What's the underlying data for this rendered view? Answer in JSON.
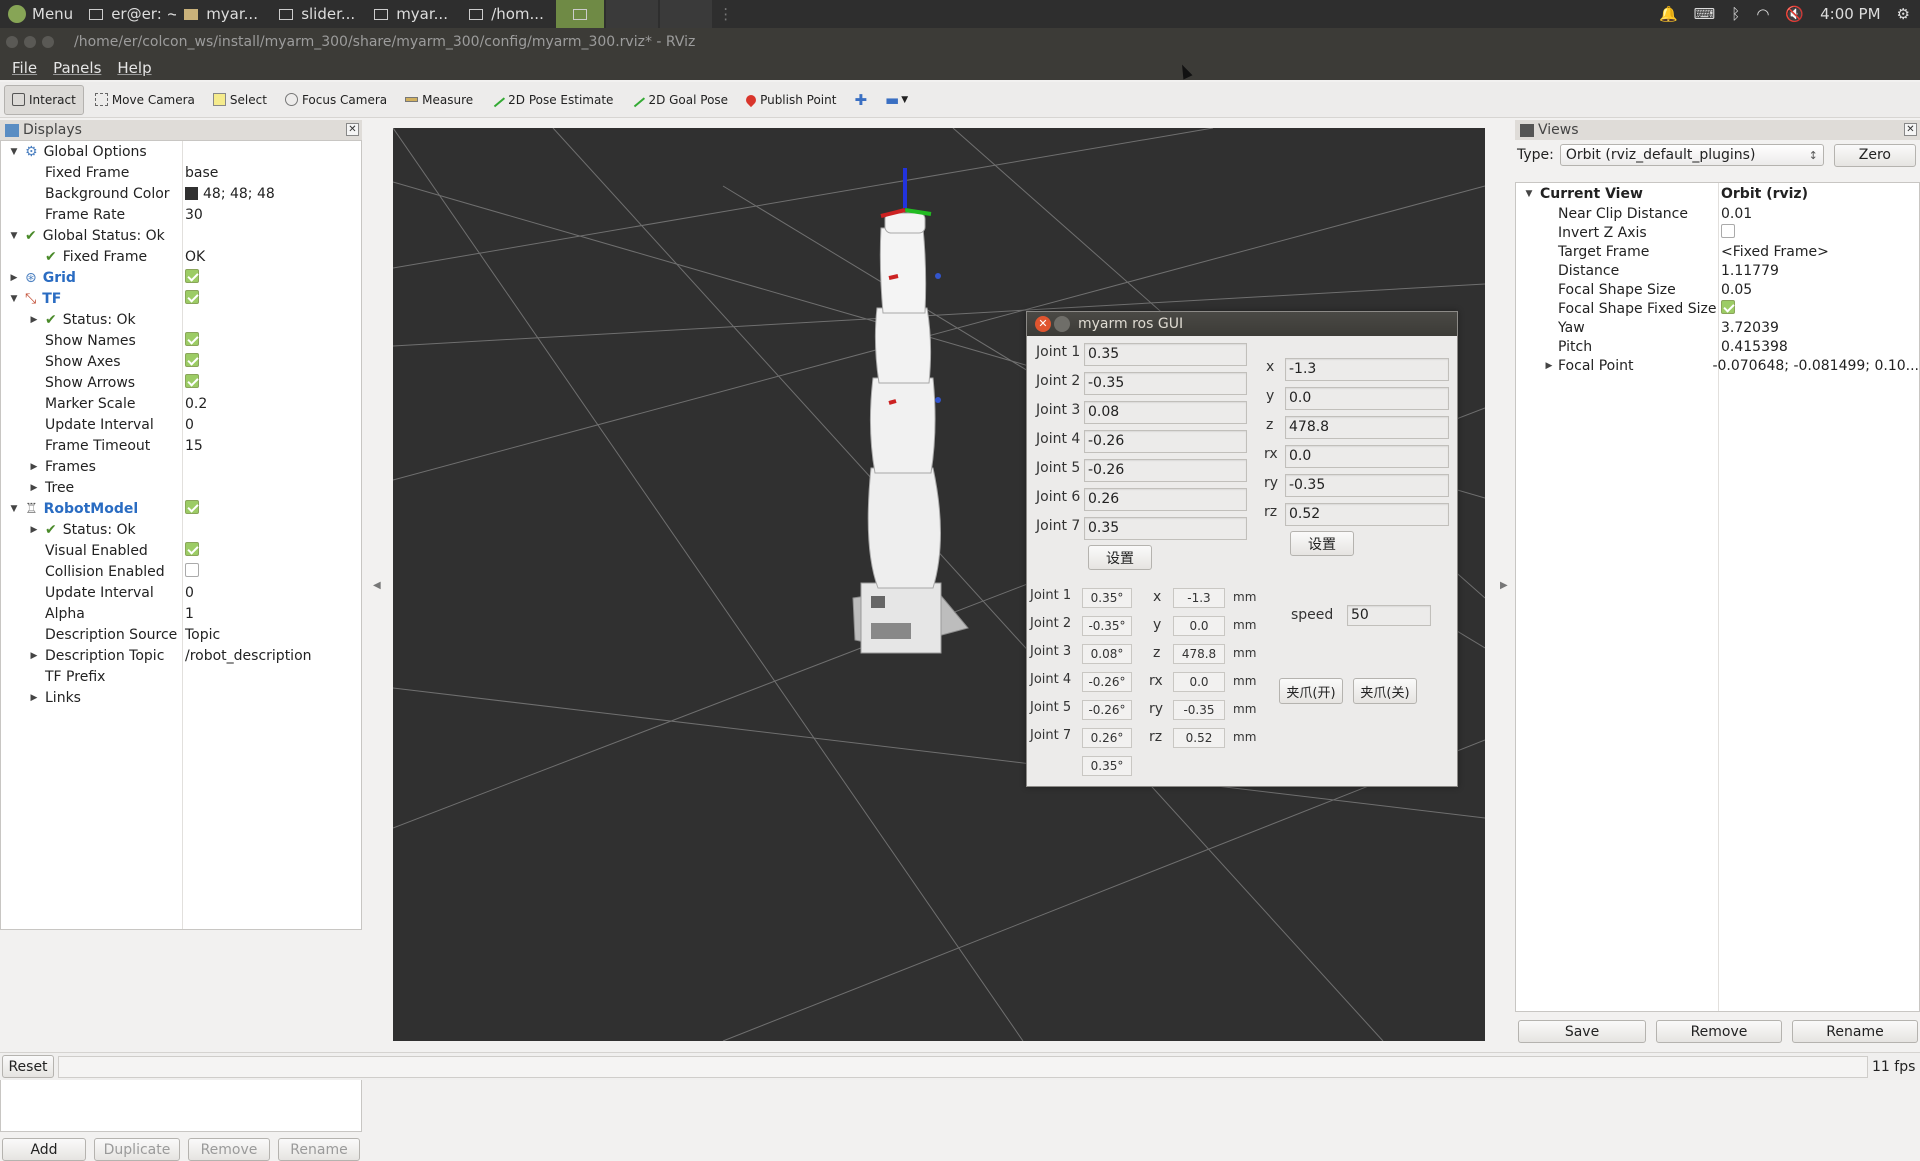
{
  "taskbar": {
    "menu_label": "Menu",
    "tasks": [
      "er@er: ~",
      "myar...",
      "slider...",
      "myar...",
      "/hom..."
    ],
    "clock": "4:00 PM"
  },
  "window": {
    "title": "/home/er/colcon_ws/install/myarm_300/share/myarm_300/config/myarm_300.rviz* - RViz"
  },
  "menubar": {
    "file": "File",
    "panels": "Panels",
    "help": "Help"
  },
  "toolbar": {
    "interact": "Interact",
    "move_camera": "Move Camera",
    "select": "Select",
    "focus_camera": "Focus Camera",
    "measure": "Measure",
    "pose_estimate": "2D Pose Estimate",
    "goal_pose": "2D Goal Pose",
    "publish_point": "Publish Point"
  },
  "displays": {
    "title": "Displays",
    "global_options": "Global Options",
    "fixed_frame_label": "Fixed Frame",
    "fixed_frame_value": "base",
    "bg_color_label": "Background Color",
    "bg_color_value": "48; 48; 48",
    "frame_rate_label": "Frame Rate",
    "frame_rate_value": "30",
    "global_status": "Global Status: Ok",
    "gs_fixed_frame": "Fixed Frame",
    "gs_fixed_frame_value": "OK",
    "grid": "Grid",
    "tf": "TF",
    "tf_status": "Status: Ok",
    "show_names": "Show Names",
    "show_axes": "Show Axes",
    "show_arrows": "Show Arrows",
    "marker_scale_label": "Marker Scale",
    "marker_scale_value": "0.2",
    "update_interval_label": "Update Interval",
    "update_interval_value": "0",
    "frame_timeout_label": "Frame Timeout",
    "frame_timeout_value": "15",
    "frames": "Frames",
    "tree": "Tree",
    "robot_model": "RobotModel",
    "rm_status": "Status: Ok",
    "visual_enabled": "Visual Enabled",
    "collision_enabled": "Collision Enabled",
    "rm_update_interval_label": "Update Interval",
    "rm_update_interval_value": "0",
    "alpha_label": "Alpha",
    "alpha_value": "1",
    "desc_source_label": "Description Source",
    "desc_source_value": "Topic",
    "desc_topic_label": "Description Topic",
    "desc_topic_value": "/robot_description",
    "tf_prefix": "TF Prefix",
    "links": "Links",
    "buttons": {
      "add": "Add",
      "duplicate": "Duplicate",
      "remove": "Remove",
      "rename": "Rename"
    }
  },
  "views": {
    "title": "Views",
    "type_label": "Type:",
    "type_value": "Orbit (rviz_default_plugins)",
    "zero": "Zero",
    "current_view": "Current View",
    "current_view_value": "Orbit (rviz)",
    "near_clip_label": "Near Clip Distance",
    "near_clip_value": "0.01",
    "invert_z_label": "Invert Z Axis",
    "target_frame_label": "Target Frame",
    "target_frame_value": "<Fixed Frame>",
    "distance_label": "Distance",
    "distance_value": "1.11779",
    "focal_size_label": "Focal Shape Size",
    "focal_size_value": "0.05",
    "focal_fixed_label": "Focal Shape Fixed Size",
    "yaw_label": "Yaw",
    "yaw_value": "3.72039",
    "pitch_label": "Pitch",
    "pitch_value": "0.415398",
    "focal_point_label": "Focal Point",
    "focal_point_value": "-0.070648; -0.081499; 0.10...",
    "buttons": {
      "save": "Save",
      "remove": "Remove",
      "rename": "Rename"
    }
  },
  "status": {
    "reset": "Reset",
    "fps": "11 fps"
  },
  "gui": {
    "title": "myarm ros GUI",
    "joint_inputs": [
      {
        "label": "Joint 1",
        "value": "0.35"
      },
      {
        "label": "Joint 2",
        "value": "-0.35"
      },
      {
        "label": "Joint 3",
        "value": "0.08"
      },
      {
        "label": "Joint 4",
        "value": "-0.26"
      },
      {
        "label": "Joint 5",
        "value": "-0.26"
      },
      {
        "label": "Joint 6",
        "value": "0.26"
      },
      {
        "label": "Joint 7",
        "value": "0.35"
      }
    ],
    "coord_inputs": [
      {
        "label": "x",
        "value": "-1.3"
      },
      {
        "label": "y",
        "value": "0.0"
      },
      {
        "label": "z",
        "value": "478.8"
      },
      {
        "label": "rx",
        "value": "0.0"
      },
      {
        "label": "ry",
        "value": "-0.35"
      },
      {
        "label": "rz",
        "value": "0.52"
      }
    ],
    "set_label": "设置",
    "readout_rows": [
      {
        "joint": "Joint 1",
        "angle": "0.35°",
        "axis": "x",
        "value": "-1.3",
        "unit": "mm"
      },
      {
        "joint": "Joint 2",
        "angle": "-0.35°",
        "axis": "y",
        "value": "0.0",
        "unit": "mm"
      },
      {
        "joint": "Joint 3",
        "angle": "0.08°",
        "axis": "z",
        "value": "478.8",
        "unit": "mm"
      },
      {
        "joint": "Joint 4",
        "angle": "-0.26°",
        "axis": "rx",
        "value": "0.0",
        "unit": "mm"
      },
      {
        "joint": "Joint 5",
        "angle": "-0.26°",
        "axis": "ry",
        "value": "-0.35",
        "unit": "mm"
      },
      {
        "joint": "Joint 7",
        "angle": "0.26°",
        "axis": "rz",
        "value": "0.52",
        "unit": "mm"
      }
    ],
    "extra_angle": "0.35°",
    "speed_label": "speed",
    "speed_value": "50",
    "gripper_open": "夹爪(开)",
    "gripper_close": "夹爪(关)"
  }
}
